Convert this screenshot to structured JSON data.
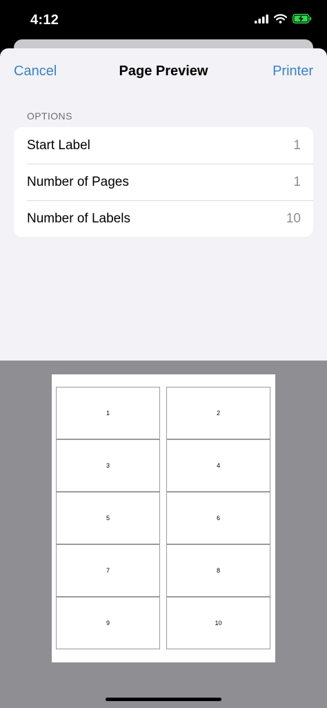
{
  "status_bar": {
    "time": "4:12"
  },
  "nav": {
    "cancel_label": "Cancel",
    "title": "Page Preview",
    "printer_label": "Printer"
  },
  "options": {
    "header": "OPTIONS",
    "rows": [
      {
        "label": "Start Label",
        "value": "1"
      },
      {
        "label": "Number of Pages",
        "value": "1"
      },
      {
        "label": "Number of Labels",
        "value": "10"
      }
    ]
  },
  "preview": {
    "labels": [
      "1",
      "2",
      "3",
      "4",
      "5",
      "6",
      "7",
      "8",
      "9",
      "10"
    ]
  },
  "colors": {
    "accent": "#3b82c4",
    "sheet_bg": "#f2f2f7",
    "preview_bg": "#8e8e93",
    "battery": "#32d74b"
  }
}
